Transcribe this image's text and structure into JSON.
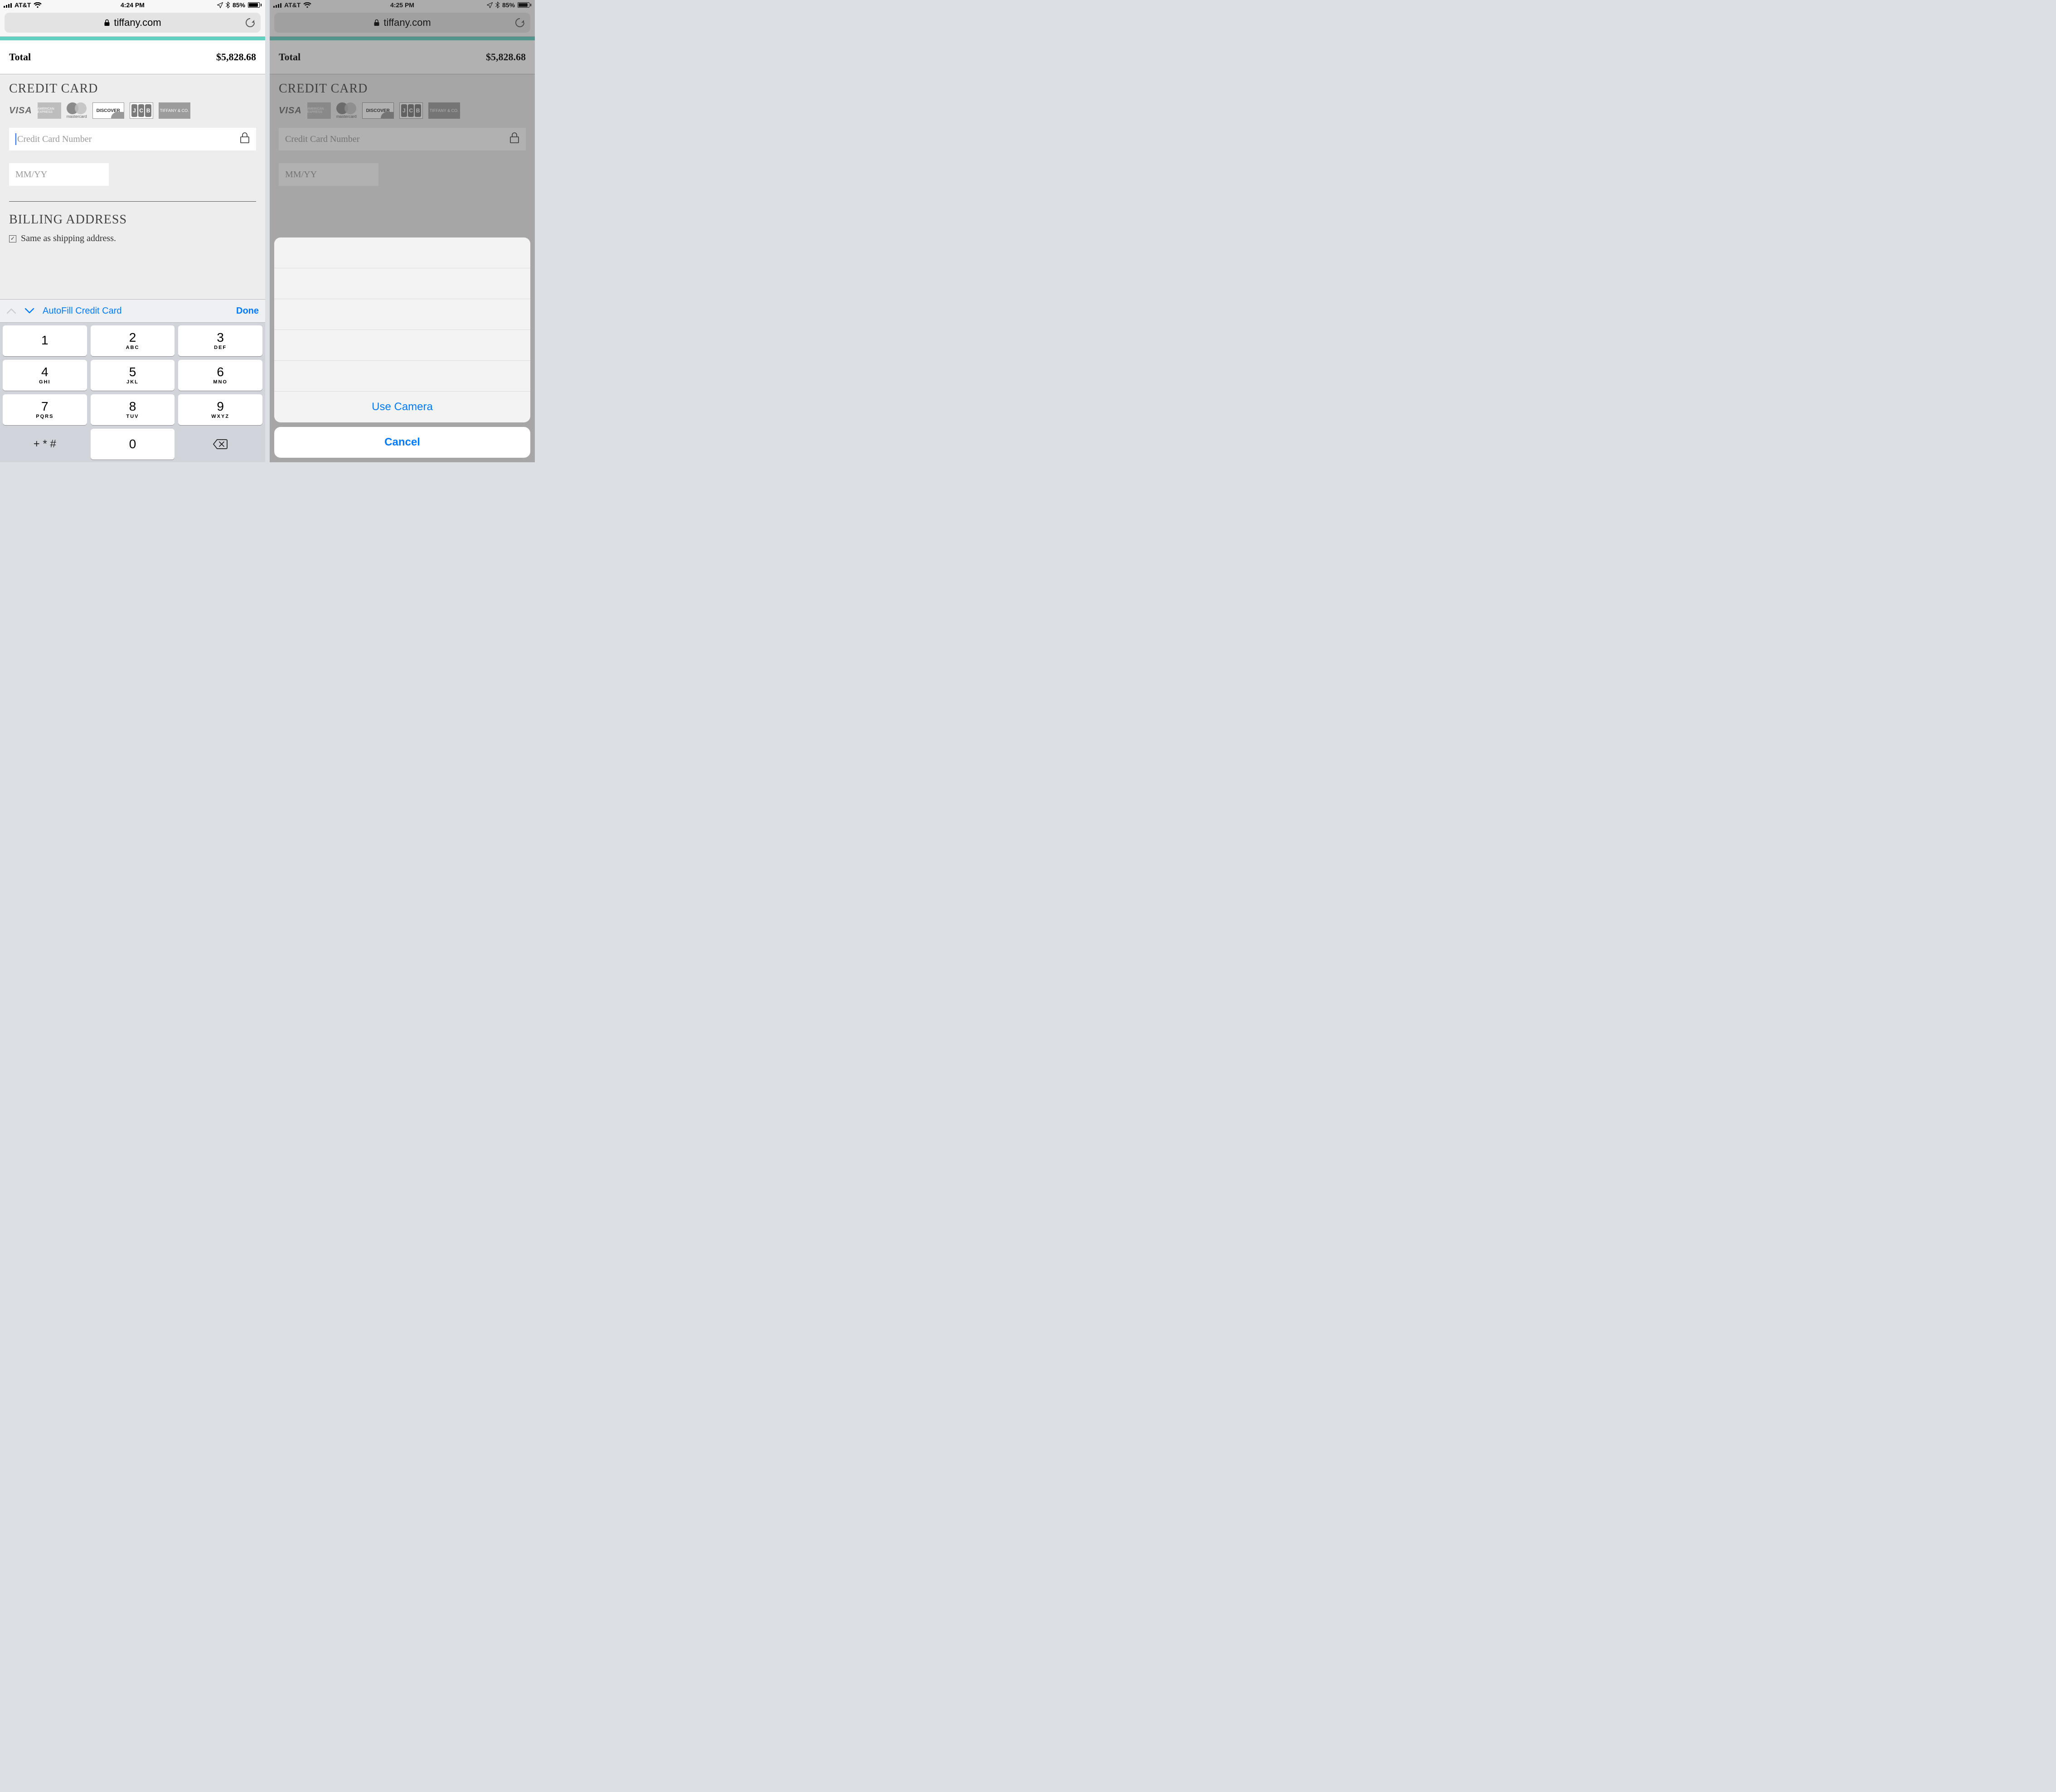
{
  "left": {
    "status": {
      "carrier": "AT&T",
      "time": "4:24 PM",
      "battery_pct": "85%"
    },
    "url": {
      "domain": "tiffany.com"
    },
    "checkout": {
      "total_label": "Total",
      "total_value": "$5,828.68",
      "cc_heading": "CREDIT CARD",
      "logos": {
        "visa": "VISA",
        "amex": "AMERICAN EXPRESS",
        "mc": "mastercard",
        "discover": "DISCOVER",
        "jcb": "JCB",
        "tiffany": "TIFFANY & CO."
      },
      "cc_placeholder": "Credit Card Number",
      "exp_placeholder": "MM/YY",
      "billing_heading": "BILLING ADDRESS",
      "same_as_label": "Same as shipping address."
    },
    "accessory": {
      "autofill": "AutoFill Credit Card",
      "done": "Done"
    },
    "keypad": {
      "k1": {
        "n": "1",
        "l": ""
      },
      "k2": {
        "n": "2",
        "l": "ABC"
      },
      "k3": {
        "n": "3",
        "l": "DEF"
      },
      "k4": {
        "n": "4",
        "l": "GHI"
      },
      "k5": {
        "n": "5",
        "l": "JKL"
      },
      "k6": {
        "n": "6",
        "l": "MNO"
      },
      "k7": {
        "n": "7",
        "l": "PQRS"
      },
      "k8": {
        "n": "8",
        "l": "TUV"
      },
      "k9": {
        "n": "9",
        "l": "WXYZ"
      },
      "sym": "+ * #",
      "k0": {
        "n": "0",
        "l": ""
      }
    }
  },
  "right": {
    "status": {
      "carrier": "AT&T",
      "time": "4:25 PM",
      "battery_pct": "85%"
    },
    "url": {
      "domain": "tiffany.com"
    },
    "checkout": {
      "total_label": "Total",
      "total_value": "$5,828.68",
      "cc_heading": "CREDIT CARD",
      "cc_placeholder": "Credit Card Number",
      "exp_placeholder": "MM/YY"
    },
    "sheet": {
      "use_camera": "Use Camera",
      "cancel": "Cancel"
    }
  }
}
